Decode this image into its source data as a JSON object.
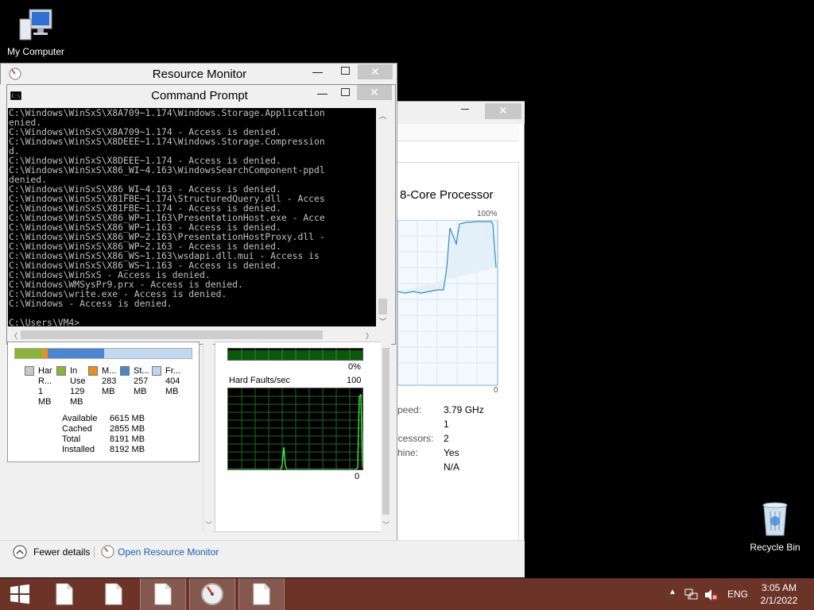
{
  "desktop": {
    "my_computer_label": "My Computer",
    "recycle_bin_label": "Recycle Bin"
  },
  "resource_monitor": {
    "title": "Resource Monitor"
  },
  "command_prompt": {
    "title": "Command Prompt",
    "lines": [
      "C:\\Windows\\WinSxS\\X8A709~1.174\\Windows.Storage.Application",
      "enied.",
      "C:\\Windows\\WinSxS\\X8A709~1.174 - Access is denied.",
      "C:\\Windows\\WinSxS\\X8DEEE~1.174\\Windows.Storage.Compression",
      "d.",
      "C:\\Windows\\WinSxS\\X8DEEE~1.174 - Access is denied.",
      "C:\\Windows\\WinSxS\\X86_WI~4.163\\WindowsSearchComponent-ppdl",
      "denied.",
      "C:\\Windows\\WinSxS\\X86_WI~4.163 - Access is denied.",
      "C:\\Windows\\WinSxS\\X81FBE~1.174\\StructuredQuery.dll - Acces",
      "C:\\Windows\\WinSxS\\X81FBE~1.174 - Access is denied.",
      "C:\\Windows\\WinSxS\\X86_WP~1.163\\PresentationHost.exe - Acce",
      "C:\\Windows\\WinSxS\\X86_WP~1.163 - Access is denied.",
      "C:\\Windows\\WinSxS\\X86_WP~2.163\\PresentationHostProxy.dll -",
      "C:\\Windows\\WinSxS\\X86_WP~2.163 - Access is denied.",
      "C:\\Windows\\WinSxS\\X86_WS~1.163\\wsdapi.dll.mui - Access is",
      "C:\\Windows\\WinSxS\\X86_WS~1.163 - Access is denied.",
      "C:\\Windows\\WinSxS - Access is denied.",
      "C:\\Windows\\WMSysPr9.prx - Access is denied.",
      "C:\\Windows\\write.exe - Access is denied.",
      "C:\\Windows - Access is denied.",
      "",
      "C:\\Users\\VM4>"
    ]
  },
  "memory": {
    "legend": [
      {
        "label1": "Har",
        "label2": "R...",
        "value1": "1",
        "value2": "MB",
        "color": "#c8c8c8"
      },
      {
        "label1": "In",
        "label2": "Use",
        "value1": "129",
        "value2": "MB",
        "color": "#8ab43b"
      },
      {
        "label1": "M...",
        "label2": "",
        "value1": "283",
        "value2": "MB",
        "color": "#e8901e"
      },
      {
        "label1": "St...",
        "label2": "",
        "value1": "257",
        "value2": "MB",
        "color": "#4a86cf"
      },
      {
        "label1": "Fr...",
        "label2": "",
        "value1": "404",
        "value2": "MB",
        "color": "#bcd4f0"
      }
    ],
    "stats": [
      {
        "label": "Available",
        "value": "6615 MB"
      },
      {
        "label": "Cached",
        "value": "2855 MB"
      },
      {
        "label": "Total",
        "value": "8191 MB"
      },
      {
        "label": "Installed",
        "value": "8192 MB"
      }
    ]
  },
  "graphs": {
    "upper_pct": "0%",
    "hard_faults_label": "Hard Faults/sec",
    "hard_faults_max": "100",
    "hard_faults_min": "0"
  },
  "task_manager": {
    "cpu_title": "8-Core Processor",
    "cpu_max": "100%",
    "cpu_min": "0",
    "info_rows": [
      {
        "label": "speed:",
        "value": "3.79 GHz"
      },
      {
        "label": "",
        "value": "1"
      },
      {
        "label": "ocessors:",
        "value": "2"
      },
      {
        "label": "chine:",
        "value": "Yes"
      },
      {
        "label": "",
        "value": "N/A"
      }
    ]
  },
  "footer": {
    "fewer_details": "Fewer details",
    "open_resource_monitor": "Open Resource Monitor"
  },
  "taskbar": {
    "language": "ENG",
    "time": "3:05 AM",
    "date": "2/1/2022"
  }
}
